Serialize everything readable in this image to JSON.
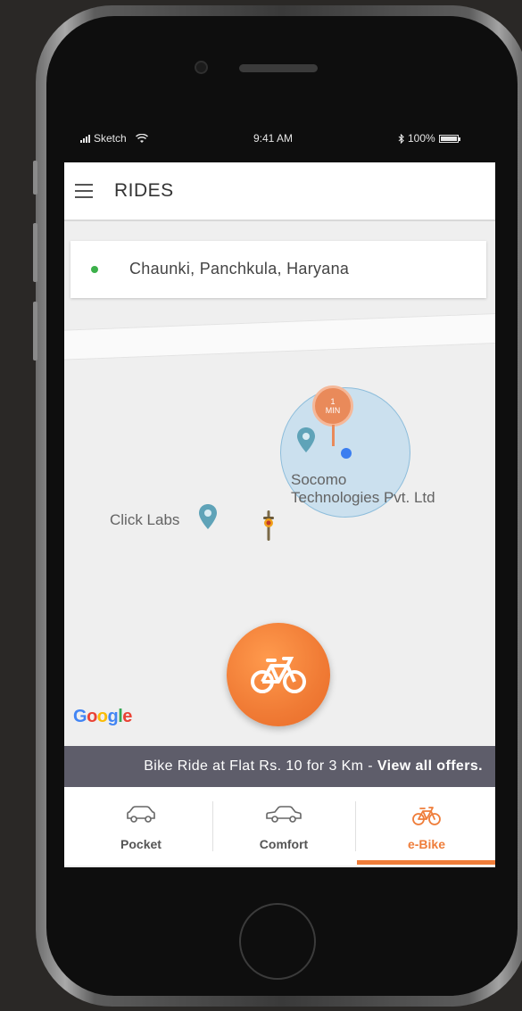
{
  "status_bar": {
    "carrier": "Sketch",
    "time": "9:41 AM",
    "battery": "100%"
  },
  "header": {
    "menu_icon": "hamburger-menu-icon",
    "title": "RIDES"
  },
  "location": {
    "text": "Chaunki, Panchkula, Haryana",
    "dot_color": "#3cb04a"
  },
  "map": {
    "eta_value": "1",
    "eta_unit": "MIN",
    "places": [
      {
        "name": "Socomo Technologies Pvt. Ltd",
        "line1": "Socomo",
        "line2": "Technologies Pvt. Ltd"
      },
      {
        "name": "Click Labs"
      }
    ],
    "attribution": {
      "g1": "G",
      "g2": "o",
      "g3": "o",
      "g4": "g",
      "g5": "l",
      "g6": "e"
    }
  },
  "fab": {
    "icon": "bicycle-icon",
    "color": "#f07b35"
  },
  "offers": {
    "text": "Bike Ride at Flat Rs. 10 for 3 Km",
    "separator": " - ",
    "link": "View all offers."
  },
  "tabs": [
    {
      "label": "Pocket",
      "icon": "car-hatchback-icon",
      "active": false
    },
    {
      "label": "Comfort",
      "icon": "car-sedan-icon",
      "active": false
    },
    {
      "label": "e-Bike",
      "icon": "bicycle-icon",
      "active": true
    }
  ],
  "colors": {
    "accent": "#ef7d3a",
    "banner": "#5e5d6a",
    "location_pin": "#5fa3b8",
    "current_location": "#3b7ef0"
  }
}
